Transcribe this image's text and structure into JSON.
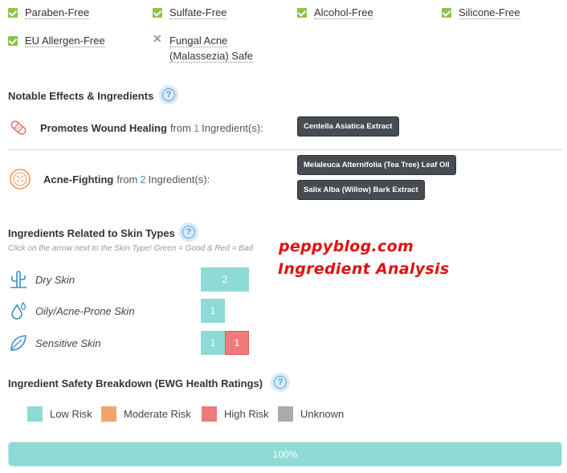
{
  "free_of": [
    {
      "label": "Paraben-Free",
      "status": "check"
    },
    {
      "label": "Sulfate-Free",
      "status": "check"
    },
    {
      "label": "Alcohol-Free",
      "status": "check"
    },
    {
      "label": "Silicone-Free",
      "status": "check"
    },
    {
      "label": "EU Allergen-Free",
      "status": "check"
    },
    {
      "label_line1": "Fungal Acne",
      "label_line2": "(Malassezia) Safe",
      "status": "cross"
    }
  ],
  "effects": {
    "title": "Notable Effects & Ingredients",
    "help": "?",
    "items": [
      {
        "name": "Promotes Wound Healing",
        "from": "from",
        "count": "1",
        "suffix": "Ingredient(s):",
        "icon": "bandage-icon",
        "tags": [
          "Centella Asiatica Extract"
        ]
      },
      {
        "name": "Acne-Fighting",
        "from": "from",
        "count": "2",
        "suffix": "Ingredient(s):",
        "icon": "cookie-icon",
        "tags": [
          "Melaleuca Alternifolia (Tea Tree) Leaf Oil",
          "Salix Alba (Willow) Bark Extract"
        ]
      }
    ]
  },
  "skin_types": {
    "title": "Ingredients Related to Skin Types",
    "help": "?",
    "hint": "Click on the arrow next to the Skin Type! Green = Good & Red = Bad",
    "rows": [
      {
        "label": "Dry Skin",
        "icon": "cactus-icon",
        "good": 2,
        "bad": null
      },
      {
        "label": "Oily/Acne-Prone Skin",
        "icon": "droplets-icon",
        "good": 1,
        "bad": null
      },
      {
        "label": "Sensitive Skin",
        "icon": "leaf-icon",
        "good": 1,
        "bad": 1
      }
    ]
  },
  "safety": {
    "title": "Ingredient Safety Breakdown (EWG Health Ratings)",
    "help": "?",
    "legend": [
      {
        "label": "Low Risk",
        "color": "#8ddbd4"
      },
      {
        "label": "Moderate Risk",
        "color": "#f2a56b"
      },
      {
        "label": "High Risk",
        "color": "#ef7a7a"
      },
      {
        "label": "Unknown",
        "color": "#aaaaaa"
      }
    ],
    "bar_label": "100%",
    "low_risk_fraction": 1.0
  },
  "watermark": {
    "line1": "peppyblog.com",
    "line2": "Ingredient Analysis"
  }
}
